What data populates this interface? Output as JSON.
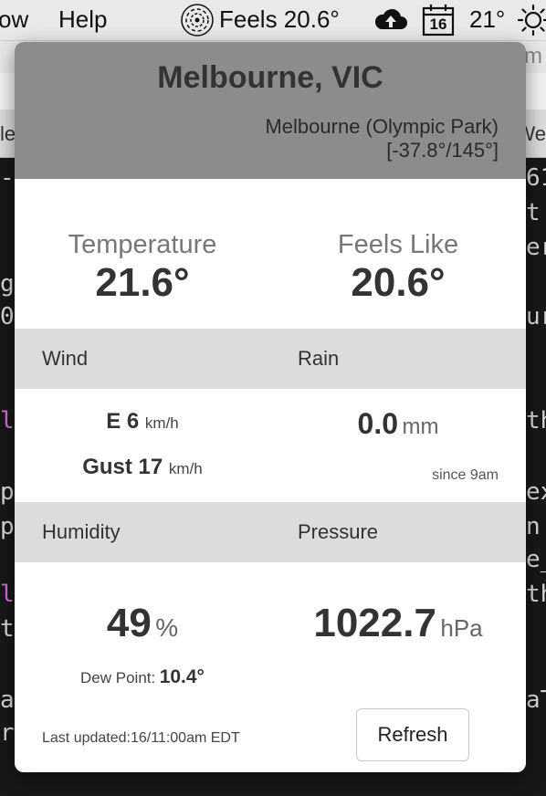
{
  "menubar": {
    "partial_menu": "ow",
    "help": "Help",
    "feels": "Feels 20.6°",
    "calendar_day": "16",
    "temp": "21°"
  },
  "background": {
    "lines": [
      "-",
      "g",
      "0",
      "l",
      "p",
      "p",
      "l",
      "t",
      "a",
      "r",
      "61",
      "t",
      "er",
      "ur",
      "th",
      "ex",
      "n",
      "e_",
      "th",
      "aT"
    ],
    "tab_text": "m",
    "tab_text2": "We",
    "tab_text3": "le"
  },
  "popover": {
    "city": "Melbourne, VIC",
    "station_name": "Melbourne (Olympic Park)",
    "station_coords": "[-37.8°/145°]",
    "temperature": {
      "label": "Temperature",
      "value": "21.6°"
    },
    "feels_like": {
      "label": "Feels Like",
      "value": "20.6°"
    },
    "wind": {
      "label": "Wind",
      "direction_speed": "E 6",
      "speed_unit": "km/h",
      "gust_label": "Gust 17",
      "gust_unit": "km/h"
    },
    "rain": {
      "label": "Rain",
      "value": "0.0",
      "unit": "mm",
      "since": "since 9am"
    },
    "humidity": {
      "label": "Humidity",
      "value": "49",
      "unit": "%",
      "dew_label": "Dew Point:",
      "dew_value": "10.4°"
    },
    "pressure": {
      "label": "Pressure",
      "value": "1022.7",
      "unit": "hPa"
    },
    "last_updated": "Last updated:16/11:00am EDT",
    "refresh_label": "Refresh"
  },
  "colors": {
    "header_bg": "#8c8c8c",
    "band_bg": "#dcdcdc",
    "text_dark": "#333333",
    "label_gray": "#777777"
  }
}
